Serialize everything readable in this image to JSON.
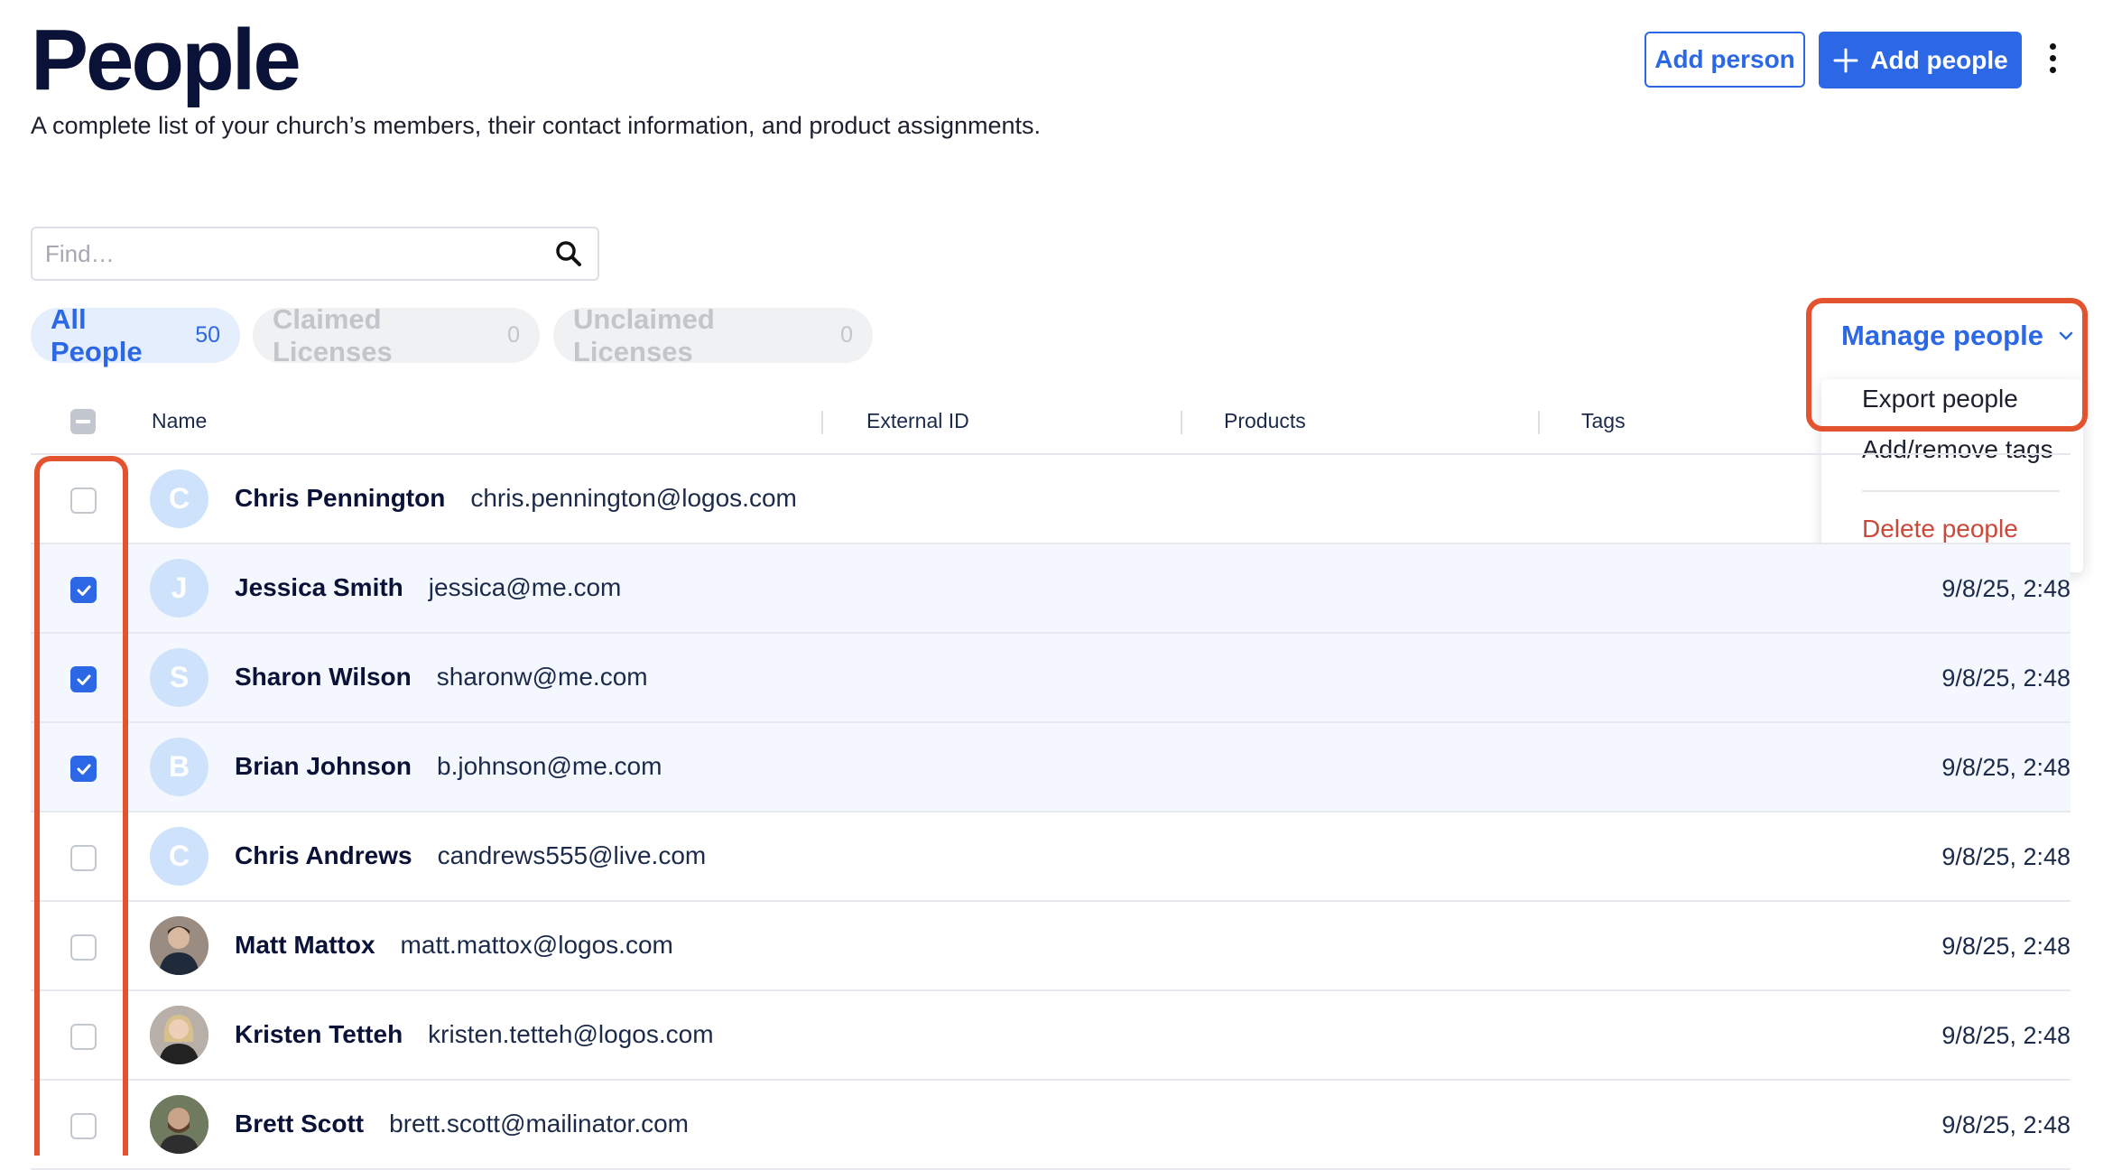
{
  "header": {
    "title": "People",
    "subtitle": "A complete list of your church’s members, their contact information, and product assignments.",
    "add_person_label": "Add person",
    "add_people_label": "Add people"
  },
  "search": {
    "placeholder": "Find…",
    "value": ""
  },
  "filters": [
    {
      "label": "All People",
      "count": "50",
      "active": true
    },
    {
      "label": "Claimed Licenses",
      "count": "0",
      "active": false
    },
    {
      "label": "Unclaimed Licenses",
      "count": "0",
      "active": false
    }
  ],
  "manage_menu": {
    "label": "Manage people",
    "items": [
      "Export people",
      "Add/remove tags",
      "Delete people"
    ]
  },
  "table": {
    "columns": [
      "Name",
      "External ID",
      "Products",
      "Tags"
    ],
    "rows": [
      {
        "initial": "C",
        "name": "Chris Pennington",
        "email": "chris.pennington@logos.com",
        "date": "",
        "checked": false
      },
      {
        "initial": "J",
        "name": "Jessica Smith",
        "email": "jessica@me.com",
        "date": "9/8/25, 2:48",
        "checked": true
      },
      {
        "initial": "S",
        "name": "Sharon Wilson",
        "email": "sharonw@me.com",
        "date": "9/8/25, 2:48",
        "checked": true
      },
      {
        "initial": "B",
        "name": "Brian Johnson",
        "email": "b.johnson@me.com",
        "date": "9/8/25, 2:48",
        "checked": true
      },
      {
        "initial": "C",
        "name": "Chris Andrews",
        "email": "candrews555@live.com",
        "date": "9/8/25, 2:48",
        "checked": false
      },
      {
        "initial": "",
        "name": "Matt Mattox",
        "email": "matt.mattox@logos.com",
        "date": "9/8/25, 2:48",
        "checked": false
      },
      {
        "initial": "",
        "name": "Kristen Tetteh",
        "email": "kristen.tetteh@logos.com",
        "date": "9/8/25, 2:48",
        "checked": false
      },
      {
        "initial": "",
        "name": "Brett Scott",
        "email": "brett.scott@mailinator.com",
        "date": "9/8/25, 2:48",
        "checked": false
      }
    ]
  },
  "colors": {
    "accent": "#2c68e5",
    "highlight": "#e4532f",
    "danger": "#c94a3a"
  },
  "icons": [
    "search-icon",
    "plus-icon",
    "kebab-menu-icon",
    "chevron-down-icon",
    "checkmark-icon"
  ]
}
